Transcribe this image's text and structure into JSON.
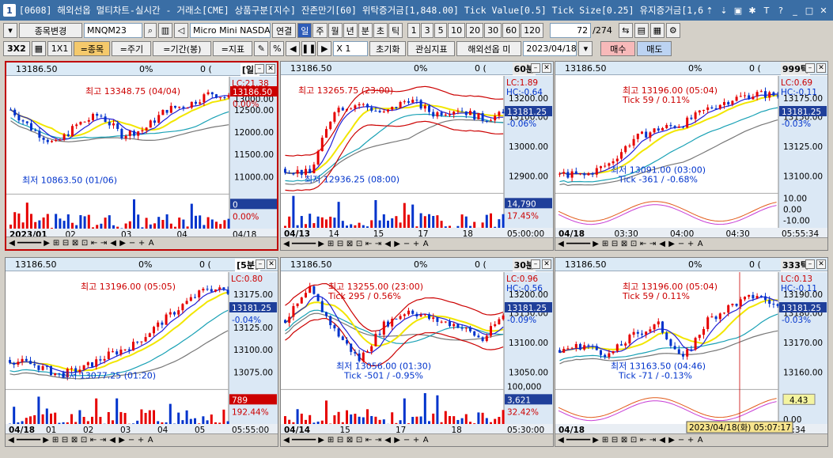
{
  "titlebar": {
    "window_number": "1",
    "title": "[0608] 해외선옵 멀티차트-실시간 - 거래소[CME] 상품구분[지수] 잔존만기[60] 위탁증거금[1,848.00] Tick Value[0.5] Tick Size[0.25] 유지증거금[1,6"
  },
  "toolbar1": {
    "change_item_label": "종목변경",
    "symbol": "MNQM23",
    "product_name": "Micro Mini NASDAQ",
    "link_label": "연결",
    "period_tabs": [
      "일",
      "주",
      "월",
      "년",
      "분",
      "초",
      "틱"
    ],
    "active_tab": "일",
    "interval_options": [
      "1",
      "3",
      "5",
      "10",
      "20",
      "30",
      "60",
      "120"
    ],
    "count": "72",
    "count_total": "/274"
  },
  "toolbar2": {
    "layout_label": "3X2",
    "layout_sub": "1X1",
    "btn_item": "=종목",
    "btn_cycle": "=주기",
    "btn_period": "=기간(봉)",
    "btn_indicator": "=지표",
    "multiplier": "X 1",
    "reset_label": "초기화",
    "interest_label": "관심지표",
    "market_label": "해외선옵 미",
    "date": "2023/04/18",
    "buy_label": "매수",
    "sell_label": "매도"
  },
  "colors": {
    "up": "#e60000",
    "down": "#0033cc",
    "ma_yellow": "#f2e600",
    "ma_blue": "#1f1fd6",
    "ma_teal": "#19a1b5",
    "ma_gray": "#777777",
    "band_red": "#cc0000",
    "accent_buy": "#f5c96b"
  },
  "panels": [
    {
      "id": "p1",
      "price": "13186.50",
      "pct": "0%",
      "vol": "0 (",
      "period": "[일]",
      "high_label": "최고 13348.75 (04/04)",
      "low_label": "최저 10863.50 (01/06)",
      "axis": [
        "13000.00",
        "12500.00",
        "12000.00",
        "11500.00",
        "11000.00"
      ],
      "lc": "LC:21.38",
      "hc": "",
      "tag_price": "13186.50",
      "tag_pct": "0.00%",
      "vol_tag": "0",
      "vol_pct": "0.00%",
      "x_labels": [
        "2023/01",
        "02",
        "03",
        "04"
      ],
      "time_label": "04/18",
      "ylim": [
        10500,
        13600
      ]
    },
    {
      "id": "p2",
      "price": "13186.50",
      "pct": "0%",
      "vol": "0 (",
      "period": "60분",
      "high_label": "최고 13265.75 (23:00)",
      "low_label": "최저 12936.25 (08:00)",
      "axis": [
        "13200.00",
        "13100.00",
        "13000.00",
        "12900.00"
      ],
      "lc": "LC:1.89",
      "hc": "HC:-0.64",
      "tag_price": "13181.25",
      "tag_pct": "-0.06%",
      "vol_tag": "14,790",
      "vol_pct": "17.45%",
      "x_labels": [
        "04/13",
        "14",
        "15",
        "17",
        "18"
      ],
      "time_label": "05:00:00",
      "ylim": [
        12850,
        13320
      ]
    },
    {
      "id": "p3",
      "price": "13186.50",
      "pct": "0%",
      "vol": "0 (",
      "period": "999틱",
      "high_label": "최고 13196.00 (05:04)",
      "high_sub": "Tick 59 / 0.11%",
      "low_label": "최저 13091.00 (03:00)",
      "low_sub": "Tick -361 / -0.68%",
      "axis": [
        "13175.00",
        "13150.00",
        "13125.00",
        "13100.00"
      ],
      "lc": "LC:0.69",
      "hc": "HC:-0.11",
      "tag_price": "13181.25",
      "tag_pct": "-0.03%",
      "osc_axis": [
        "10.00",
        "0.00",
        "-10.00"
      ],
      "x_labels": [
        "04/18",
        "03:30",
        "04:00",
        "04:30"
      ],
      "time_label": "05:55:34",
      "ylim": [
        13085,
        13205
      ]
    },
    {
      "id": "p4",
      "price": "13186.50",
      "pct": "0%",
      "vol": "0 (",
      "period": "[5분]",
      "high_label": "최고 13196.00 (05:05)",
      "low_label": "최저 13077.25 (01:20)",
      "axis": [
        "13175.00",
        "13150.00",
        "13125.00",
        "13100.00",
        "13075.00"
      ],
      "lc": "LC:0.80",
      "hc": "",
      "tag_price": "13181.25",
      "tag_pct": "-0.04%",
      "vol_tag": "789",
      "vol_pct": "192.44%",
      "x_labels": [
        "04/18",
        "01",
        "02",
        "03",
        "04",
        "05"
      ],
      "time_label": "05:55:00",
      "ylim": [
        13060,
        13205
      ]
    },
    {
      "id": "p5",
      "price": "13186.50",
      "pct": "0%",
      "vol": "0 (",
      "period": "30분",
      "high_label": "최고 13255.00 (23:00)",
      "high_sub": "Tick 295 / 0.56%",
      "low_label": "최저 13056.00 (01:30)",
      "low_sub": "Tick -501 / -0.95%",
      "axis": [
        "13200.00",
        "13150.00",
        "13100.00",
        "13050.00"
      ],
      "lc": "LC:0.96",
      "hc": "HC:-0.56",
      "tag_price": "13181.25",
      "tag_pct": "-0.09%",
      "vol_tag": "3,621",
      "vol_pct": "32.42%",
      "vol_axis": "100,000",
      "x_labels": [
        "04/14",
        "15",
        "17",
        "18"
      ],
      "time_label": "05:30:00",
      "ylim": [
        13030,
        13270
      ]
    },
    {
      "id": "p6",
      "price": "13186.50",
      "pct": "0%",
      "vol": "0 (",
      "period": "333틱",
      "high_label": "최고 13196.00 (05:04)",
      "high_sub": "Tick 59 / 0.11%",
      "low_label": "최저 13163.50 (04:46)",
      "low_sub": "Tick -71 / -0.13%",
      "axis": [
        "13190.00",
        "13180.00",
        "13170.00",
        "13160.00"
      ],
      "lc": "LC:0.13",
      "hc": "HC:-0.11",
      "tag_price": "13181.25",
      "tag_pct": "-0.03%",
      "osc_value": "4.43",
      "osc_axis": "0.00",
      "x_labels": [
        "04/18"
      ],
      "time_label": "05:34",
      "tooltip": "2023/04/18(화) 05:07:17",
      "ylim": [
        13155,
        13200
      ]
    }
  ]
}
